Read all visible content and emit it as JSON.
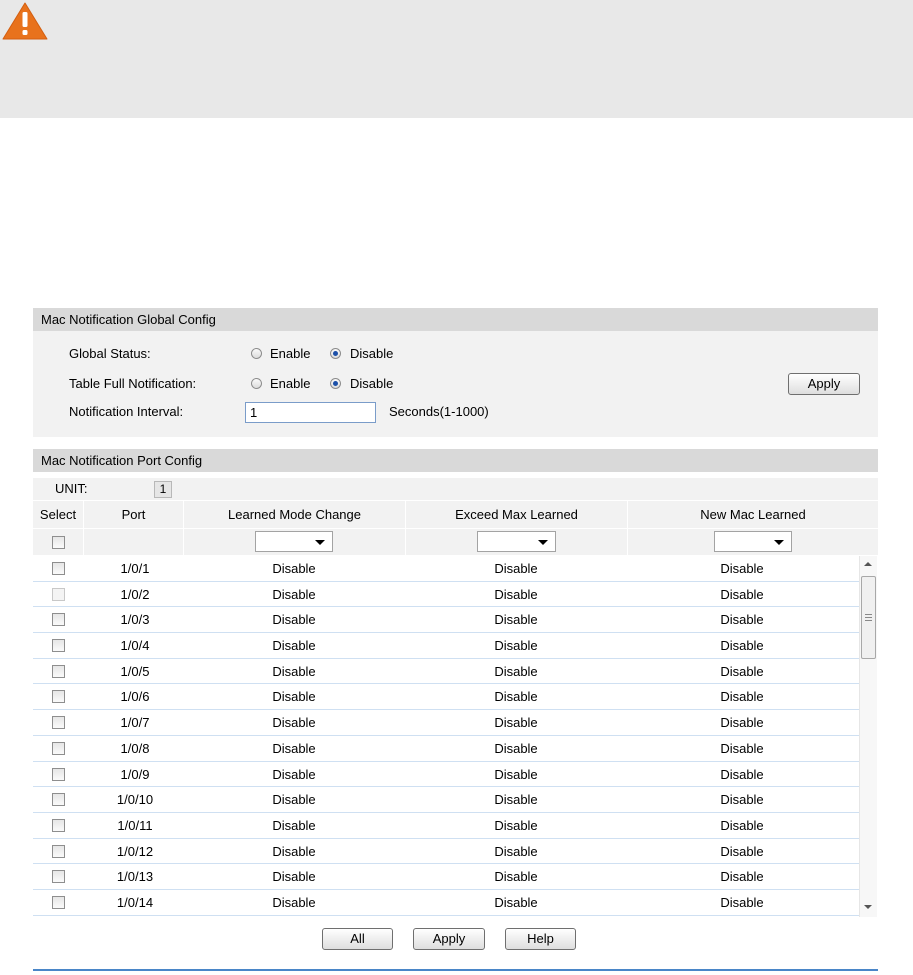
{
  "global_config": {
    "section_title": "Mac Notification Global Config",
    "global_status": {
      "label": "Global Status:",
      "options": [
        "Enable",
        "Disable"
      ],
      "selected": "Disable"
    },
    "table_full_notification": {
      "label": "Table Full Notification:",
      "options": [
        "Enable",
        "Disable"
      ],
      "selected": "Disable"
    },
    "notification_interval": {
      "label": "Notification Interval:",
      "value": "1",
      "unit": "Seconds(1-1000)"
    },
    "apply_label": "Apply"
  },
  "port_config": {
    "section_title": "Mac Notification Port Config",
    "unit_label": "UNIT:",
    "unit_value": "1",
    "columns": [
      "Select",
      "Port",
      "Learned Mode Change",
      "Exceed Max Learned",
      "New Mac Learned"
    ],
    "filters": {
      "learned_mode_change": "",
      "exceed_max_learned": "",
      "new_mac_learned": ""
    },
    "rows": [
      {
        "port": "1/0/1",
        "learned_mode_change": "Disable",
        "exceed_max_learned": "Disable",
        "new_mac_learned": "Disable"
      },
      {
        "port": "1/0/2",
        "learned_mode_change": "Disable",
        "exceed_max_learned": "Disable",
        "new_mac_learned": "Disable"
      },
      {
        "port": "1/0/3",
        "learned_mode_change": "Disable",
        "exceed_max_learned": "Disable",
        "new_mac_learned": "Disable"
      },
      {
        "port": "1/0/4",
        "learned_mode_change": "Disable",
        "exceed_max_learned": "Disable",
        "new_mac_learned": "Disable"
      },
      {
        "port": "1/0/5",
        "learned_mode_change": "Disable",
        "exceed_max_learned": "Disable",
        "new_mac_learned": "Disable"
      },
      {
        "port": "1/0/6",
        "learned_mode_change": "Disable",
        "exceed_max_learned": "Disable",
        "new_mac_learned": "Disable"
      },
      {
        "port": "1/0/7",
        "learned_mode_change": "Disable",
        "exceed_max_learned": "Disable",
        "new_mac_learned": "Disable"
      },
      {
        "port": "1/0/8",
        "learned_mode_change": "Disable",
        "exceed_max_learned": "Disable",
        "new_mac_learned": "Disable"
      },
      {
        "port": "1/0/9",
        "learned_mode_change": "Disable",
        "exceed_max_learned": "Disable",
        "new_mac_learned": "Disable"
      },
      {
        "port": "1/0/10",
        "learned_mode_change": "Disable",
        "exceed_max_learned": "Disable",
        "new_mac_learned": "Disable"
      },
      {
        "port": "1/0/11",
        "learned_mode_change": "Disable",
        "exceed_max_learned": "Disable",
        "new_mac_learned": "Disable"
      },
      {
        "port": "1/0/12",
        "learned_mode_change": "Disable",
        "exceed_max_learned": "Disable",
        "new_mac_learned": "Disable"
      },
      {
        "port": "1/0/13",
        "learned_mode_change": "Disable",
        "exceed_max_learned": "Disable",
        "new_mac_learned": "Disable"
      },
      {
        "port": "1/0/14",
        "learned_mode_change": "Disable",
        "exceed_max_learned": "Disable",
        "new_mac_learned": "Disable"
      }
    ],
    "buttons": {
      "all": "All",
      "apply": "Apply",
      "help": "Help"
    }
  },
  "colors": {
    "warning_icon": "#e8721c",
    "section_header_bg": "#d9d9d9",
    "panel_bg": "#f2f2f2",
    "row_divider": "#cfe0f2",
    "bottom_rule": "#4a86c8"
  }
}
